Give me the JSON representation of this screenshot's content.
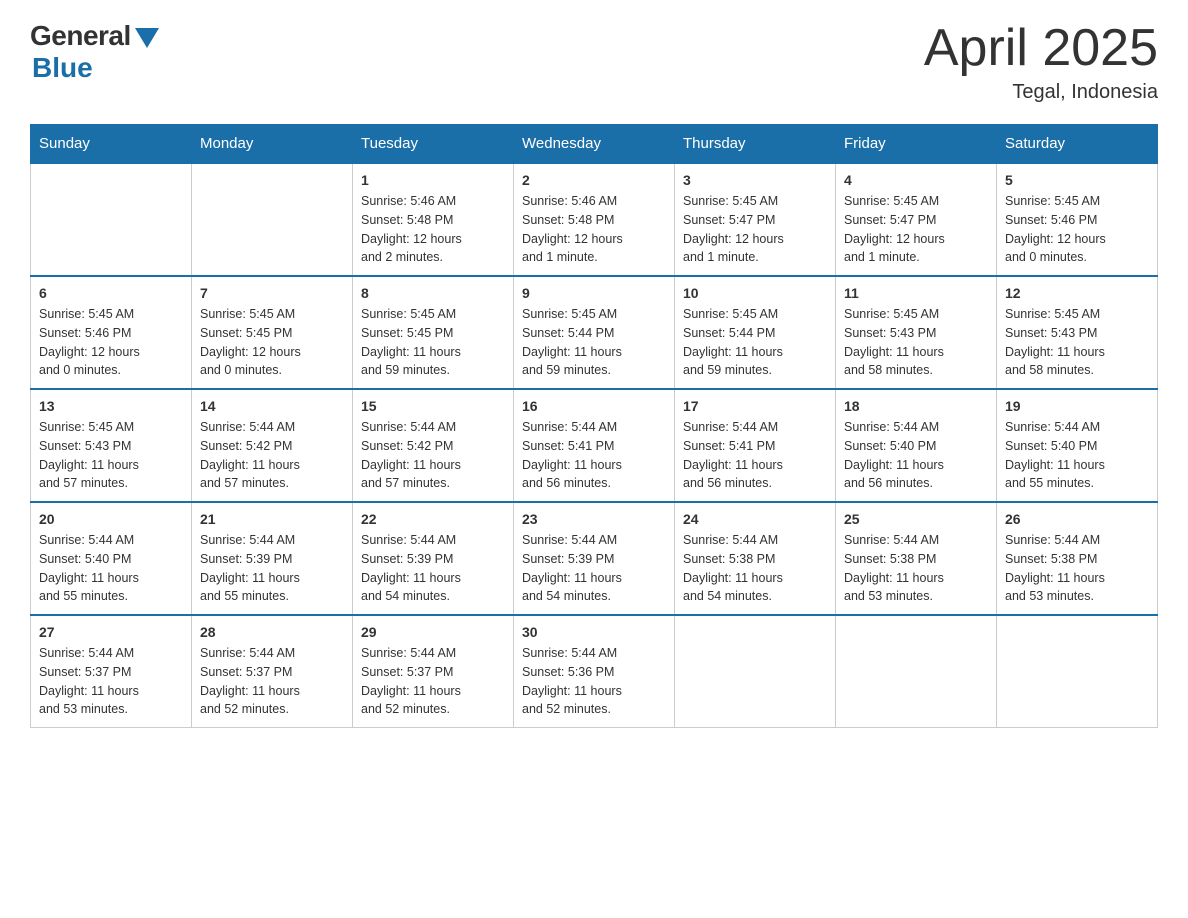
{
  "logo": {
    "general": "General",
    "blue": "Blue"
  },
  "header": {
    "month": "April 2025",
    "location": "Tegal, Indonesia"
  },
  "days_of_week": [
    "Sunday",
    "Monday",
    "Tuesday",
    "Wednesday",
    "Thursday",
    "Friday",
    "Saturday"
  ],
  "weeks": [
    [
      {
        "day": "",
        "info": ""
      },
      {
        "day": "",
        "info": ""
      },
      {
        "day": "1",
        "info": "Sunrise: 5:46 AM\nSunset: 5:48 PM\nDaylight: 12 hours\nand 2 minutes."
      },
      {
        "day": "2",
        "info": "Sunrise: 5:46 AM\nSunset: 5:48 PM\nDaylight: 12 hours\nand 1 minute."
      },
      {
        "day": "3",
        "info": "Sunrise: 5:45 AM\nSunset: 5:47 PM\nDaylight: 12 hours\nand 1 minute."
      },
      {
        "day": "4",
        "info": "Sunrise: 5:45 AM\nSunset: 5:47 PM\nDaylight: 12 hours\nand 1 minute."
      },
      {
        "day": "5",
        "info": "Sunrise: 5:45 AM\nSunset: 5:46 PM\nDaylight: 12 hours\nand 0 minutes."
      }
    ],
    [
      {
        "day": "6",
        "info": "Sunrise: 5:45 AM\nSunset: 5:46 PM\nDaylight: 12 hours\nand 0 minutes."
      },
      {
        "day": "7",
        "info": "Sunrise: 5:45 AM\nSunset: 5:45 PM\nDaylight: 12 hours\nand 0 minutes."
      },
      {
        "day": "8",
        "info": "Sunrise: 5:45 AM\nSunset: 5:45 PM\nDaylight: 11 hours\nand 59 minutes."
      },
      {
        "day": "9",
        "info": "Sunrise: 5:45 AM\nSunset: 5:44 PM\nDaylight: 11 hours\nand 59 minutes."
      },
      {
        "day": "10",
        "info": "Sunrise: 5:45 AM\nSunset: 5:44 PM\nDaylight: 11 hours\nand 59 minutes."
      },
      {
        "day": "11",
        "info": "Sunrise: 5:45 AM\nSunset: 5:43 PM\nDaylight: 11 hours\nand 58 minutes."
      },
      {
        "day": "12",
        "info": "Sunrise: 5:45 AM\nSunset: 5:43 PM\nDaylight: 11 hours\nand 58 minutes."
      }
    ],
    [
      {
        "day": "13",
        "info": "Sunrise: 5:45 AM\nSunset: 5:43 PM\nDaylight: 11 hours\nand 57 minutes."
      },
      {
        "day": "14",
        "info": "Sunrise: 5:44 AM\nSunset: 5:42 PM\nDaylight: 11 hours\nand 57 minutes."
      },
      {
        "day": "15",
        "info": "Sunrise: 5:44 AM\nSunset: 5:42 PM\nDaylight: 11 hours\nand 57 minutes."
      },
      {
        "day": "16",
        "info": "Sunrise: 5:44 AM\nSunset: 5:41 PM\nDaylight: 11 hours\nand 56 minutes."
      },
      {
        "day": "17",
        "info": "Sunrise: 5:44 AM\nSunset: 5:41 PM\nDaylight: 11 hours\nand 56 minutes."
      },
      {
        "day": "18",
        "info": "Sunrise: 5:44 AM\nSunset: 5:40 PM\nDaylight: 11 hours\nand 56 minutes."
      },
      {
        "day": "19",
        "info": "Sunrise: 5:44 AM\nSunset: 5:40 PM\nDaylight: 11 hours\nand 55 minutes."
      }
    ],
    [
      {
        "day": "20",
        "info": "Sunrise: 5:44 AM\nSunset: 5:40 PM\nDaylight: 11 hours\nand 55 minutes."
      },
      {
        "day": "21",
        "info": "Sunrise: 5:44 AM\nSunset: 5:39 PM\nDaylight: 11 hours\nand 55 minutes."
      },
      {
        "day": "22",
        "info": "Sunrise: 5:44 AM\nSunset: 5:39 PM\nDaylight: 11 hours\nand 54 minutes."
      },
      {
        "day": "23",
        "info": "Sunrise: 5:44 AM\nSunset: 5:39 PM\nDaylight: 11 hours\nand 54 minutes."
      },
      {
        "day": "24",
        "info": "Sunrise: 5:44 AM\nSunset: 5:38 PM\nDaylight: 11 hours\nand 54 minutes."
      },
      {
        "day": "25",
        "info": "Sunrise: 5:44 AM\nSunset: 5:38 PM\nDaylight: 11 hours\nand 53 minutes."
      },
      {
        "day": "26",
        "info": "Sunrise: 5:44 AM\nSunset: 5:38 PM\nDaylight: 11 hours\nand 53 minutes."
      }
    ],
    [
      {
        "day": "27",
        "info": "Sunrise: 5:44 AM\nSunset: 5:37 PM\nDaylight: 11 hours\nand 53 minutes."
      },
      {
        "day": "28",
        "info": "Sunrise: 5:44 AM\nSunset: 5:37 PM\nDaylight: 11 hours\nand 52 minutes."
      },
      {
        "day": "29",
        "info": "Sunrise: 5:44 AM\nSunset: 5:37 PM\nDaylight: 11 hours\nand 52 minutes."
      },
      {
        "day": "30",
        "info": "Sunrise: 5:44 AM\nSunset: 5:36 PM\nDaylight: 11 hours\nand 52 minutes."
      },
      {
        "day": "",
        "info": ""
      },
      {
        "day": "",
        "info": ""
      },
      {
        "day": "",
        "info": ""
      }
    ]
  ]
}
